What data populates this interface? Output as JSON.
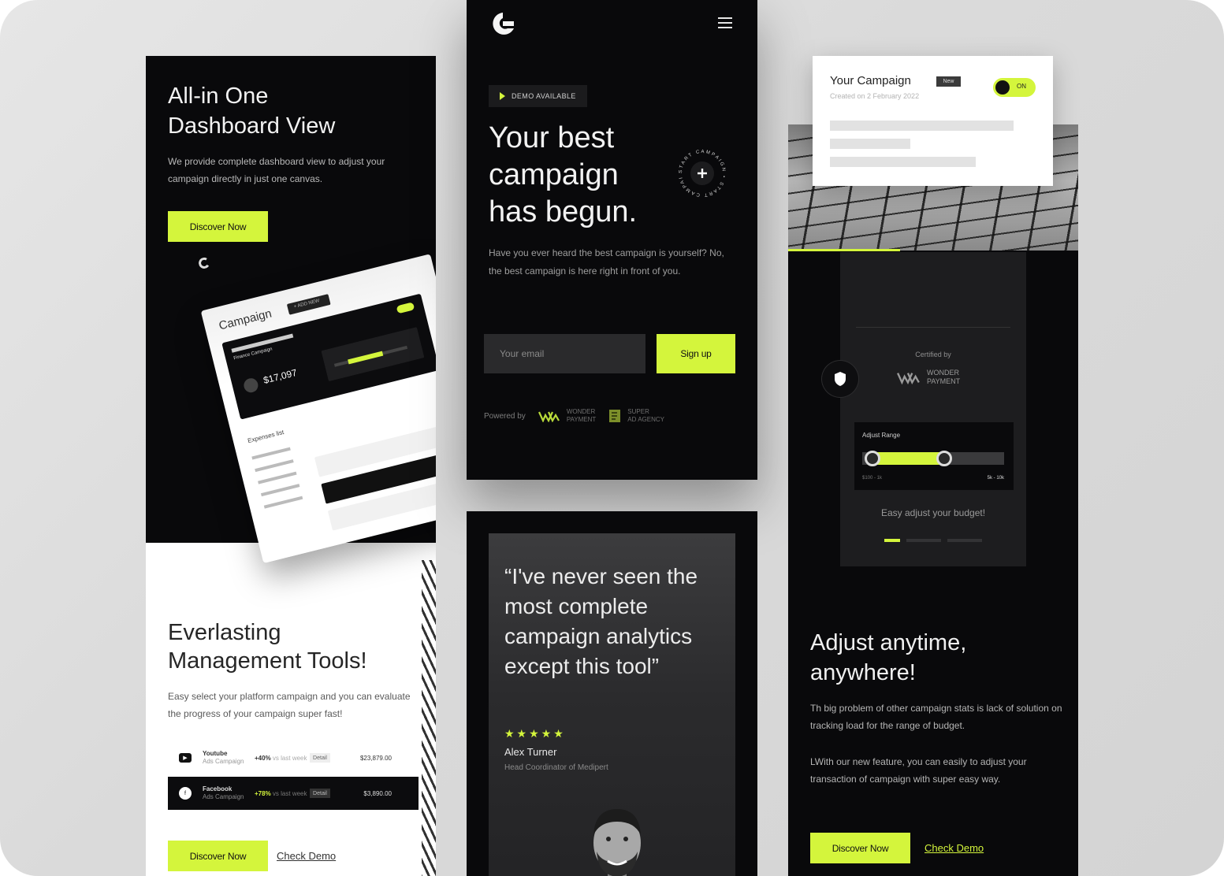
{
  "colors": {
    "accent": "#d4f53c",
    "dark": "#09090b",
    "canvas": "#dcdcdc"
  },
  "left_panel": {
    "hero_title_line1": "All-in One",
    "hero_title_line2": "Dashboard View",
    "hero_desc": "We provide complete dashboard view to adjust your campaign directly in just one canvas.",
    "hero_button": "Discover Now",
    "mockup": {
      "title": "Campaign",
      "pill": "+ ADD NEW",
      "card_title": "Finance Campaign",
      "amount": "$17,097",
      "section": "Expenses list"
    },
    "tools_title_line1": "Everlasting",
    "tools_title_line2": "Management Tools!",
    "tools_desc": "Easy select your platform campaign and you can evaluate the progress of your campaign super fast!",
    "platforms": [
      {
        "icon": "youtube-icon",
        "name": "Youtube",
        "sub": "Ads Campaign",
        "pct": "+40%",
        "pct_note": "vs last week",
        "badge": "Detail",
        "amount": "$23,879.00"
      },
      {
        "icon": "facebook-icon",
        "name": "Facebook",
        "sub": "Ads Campaign",
        "pct": "+78%",
        "pct_note": "vs last week",
        "badge": "Detail",
        "amount": "$3,890.00"
      }
    ],
    "bottom_button": "Discover Now",
    "bottom_link": "Check Demo"
  },
  "mid_panel": {
    "badge": "DEMO AVAILABLE",
    "hero_line1": "Your best",
    "hero_line2": "campaign",
    "hero_line3": "has begun.",
    "rotating_text": "START CAMPAIGN • START CAMPAIGN •",
    "desc": "Have you ever heard the best campaign is yourself? No, the best campaign is here right in front of you.",
    "email_placeholder": "Your email",
    "signup": "Sign up",
    "powered_by": "Powered by",
    "partner1_line1": "WONDER",
    "partner1_line2": "PAYMENT",
    "partner2_line1": "SUPER",
    "partner2_line2": "AD AGENCY"
  },
  "testimonial": {
    "quote": "“I've never seen the most complete campaign analytics except this tool”",
    "stars": "★★★★★",
    "rating": 5,
    "name": "Alex Turner",
    "role": "Head Coordinator of Medipert"
  },
  "right_panel": {
    "certified": "Certified by",
    "cert_line1": "WONDER",
    "cert_line2": "PAYMENT",
    "range_label": "Adjust Range",
    "range_min": "$100 - 1k",
    "range_max": "5k - 10k",
    "range_low": 0.07,
    "range_high": 0.58,
    "easy": "Easy adjust your budget!",
    "active_dot": 0,
    "title_line1": "Adjust anytime,",
    "title_line2": "anywhere!",
    "desc1": "Th big problem of other campaign stats is lack of solution on tracking load for the range of budget.",
    "desc2": "LWith our new feature, you can easily to adjust your transaction of campaign with super easy way.",
    "button": "Discover Now",
    "link": "Check Demo"
  },
  "campaign_card": {
    "title": "Your Campaign",
    "badge": "New",
    "created": "Created on 2 February 2022",
    "toggle": "ON"
  }
}
